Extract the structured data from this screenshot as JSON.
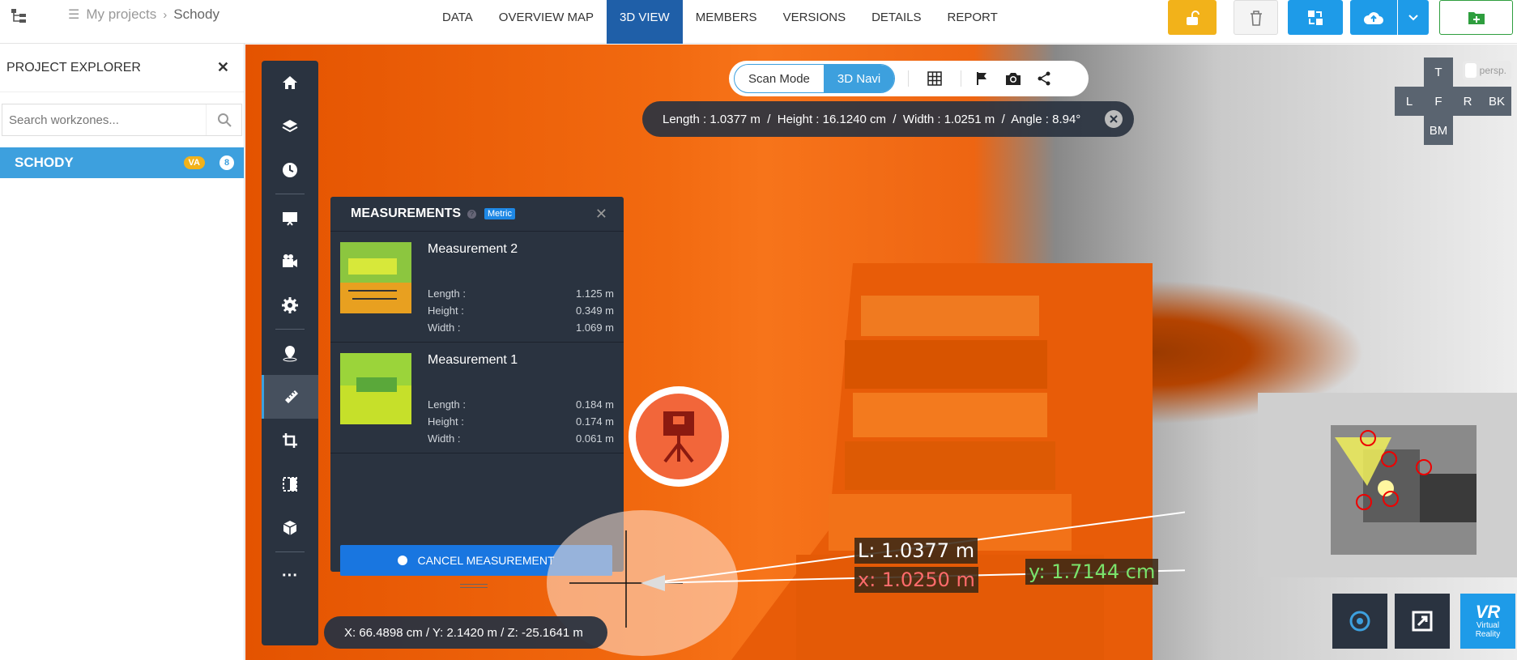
{
  "header": {
    "breadcrumb": {
      "parent": "My projects",
      "current": "Schody"
    },
    "nav": [
      "DATA",
      "OVERVIEW MAP",
      "3D VIEW",
      "MEMBERS",
      "VERSIONS",
      "DETAILS",
      "REPORT"
    ],
    "active_tab": "3D VIEW"
  },
  "sidebar": {
    "title": "PROJECT EXPLORER",
    "search_placeholder": "Search workzones...",
    "workzone": {
      "name": "SCHODY",
      "badge": "VA",
      "count": "8"
    }
  },
  "view_tools": {
    "scan_mode": "Scan Mode",
    "nav_3d": "3D Navi",
    "active_mode": "3D Navi"
  },
  "dimensions_bar": {
    "text": "Length : 1.0377 m  /  Height : 16.1240 cm  /  Width : 1.0251 m  /  Angle : 8.94°"
  },
  "view_cube": {
    "top": "T",
    "left": "L",
    "front": "F",
    "right": "R",
    "back": "BK",
    "bottom": "BM",
    "projection": "persp."
  },
  "measurements": {
    "title": "MEASUREMENTS",
    "units_badge": "Metric",
    "items": [
      {
        "name": "Measurement 2",
        "length_label": "Length :",
        "length": "1.125 m",
        "height_label": "Height :",
        "height": "0.349 m",
        "width_label": "Width :",
        "width": "1.069 m"
      },
      {
        "name": "Measurement 1",
        "length_label": "Length :",
        "length": "0.184 m",
        "height_label": "Height :",
        "height": "0.174 m",
        "width_label": "Width :",
        "width": "0.061 m"
      }
    ],
    "cancel_label": "CANCEL MEASUREMENT"
  },
  "scene_labels": {
    "length": "L: 1.0377 m",
    "x": "x: 1.0250 m",
    "y": "y: 1.7144 cm"
  },
  "coordinates": "X: 66.4898 cm / Y: 2.1420 m / Z: -25.1641 m",
  "vr_button": {
    "line1": "VR",
    "line2": "Virtual",
    "line3": "Reality"
  },
  "colors": {
    "accent": "#3da0de",
    "panel": "#2a3340",
    "lock_button": "#f2b21a",
    "primary_button": "#1976e0",
    "add_button": "#2e9e3e"
  }
}
